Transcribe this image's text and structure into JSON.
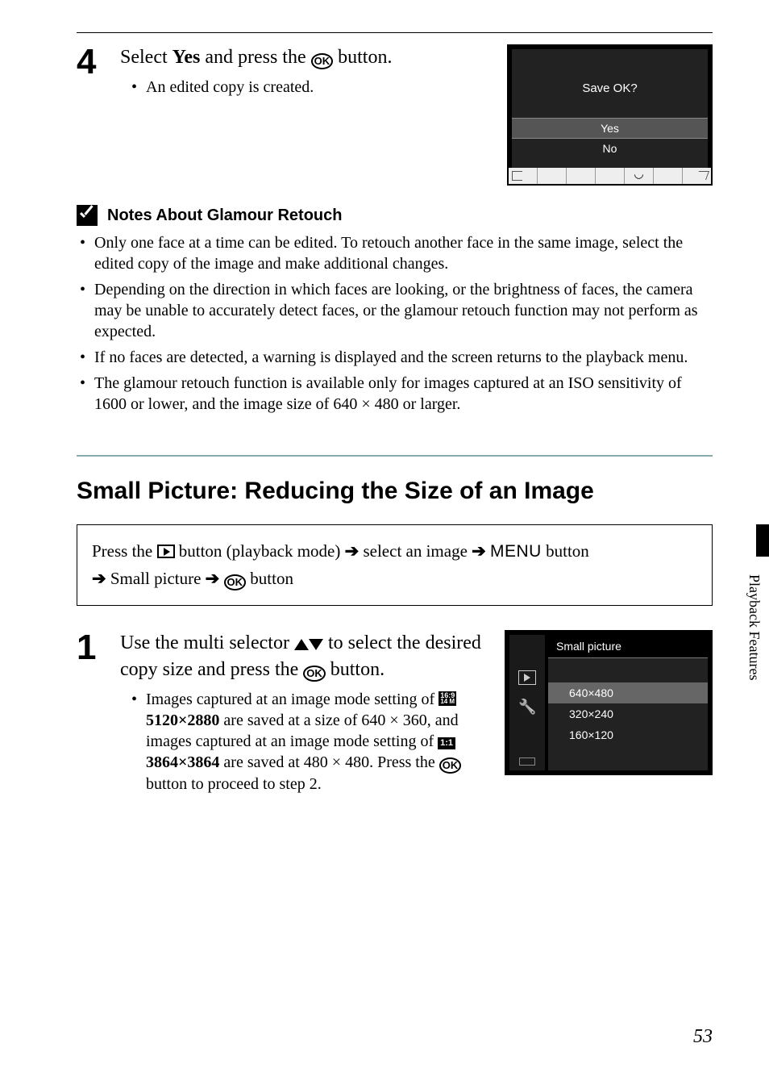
{
  "step4": {
    "number": "4",
    "head_pre": "Select ",
    "head_yes": "Yes",
    "head_mid": " and press the ",
    "head_post": " button.",
    "bullet": "An edited copy is created.",
    "screen": {
      "title": "Save OK?",
      "yes": "Yes",
      "no": "No"
    }
  },
  "notes": {
    "title": "Notes About Glamour Retouch",
    "items": [
      "Only one face at a time can be edited. To retouch another face in the same image, select the edited copy of the image and make additional changes.",
      "Depending on the direction in which faces are looking, or the brightness of faces, the camera may be unable to accurately detect faces, or the glamour retouch function may not perform as expected.",
      "If no faces are detected, a warning is displayed and the screen returns to the playback menu.",
      "The glamour retouch function is available only for images captured at an ISO sensitivity of 1600 or lower, and the image size of 640 × 480 or larger."
    ]
  },
  "section": {
    "title": "Small Picture: Reducing the Size of an Image"
  },
  "breadcrumb": {
    "p1": "Press the ",
    "p2": " button (playback mode) ",
    "p3": " select an image ",
    "p4_menu": "MENU",
    "p4_btn": " button ",
    "p5": " Small picture ",
    "p6": " button"
  },
  "step1": {
    "number": "1",
    "head_a": "Use the multi selector ",
    "head_b": " to select the desired copy size and press the ",
    "head_c": " button.",
    "bullet_a": "Images captured at an image mode setting of ",
    "mode169_label_a": "16:9",
    "mode169_label_b": "14 M",
    "mode169_size": "5120×2880",
    "bullet_b": " are saved at a size of 640 × 360, and images captured at an image mode setting of ",
    "mode11_label": "1:1",
    "mode11_size": "3864×3864",
    "bullet_c": " are saved at 480 × 480. Press the ",
    "bullet_d": " button to proceed to step 2.",
    "screen": {
      "title": "Small picture",
      "opts": [
        "640×480",
        "320×240",
        "160×120"
      ]
    }
  },
  "sidebar": "Playback Features",
  "page_number": "53",
  "ok_label": "OK"
}
